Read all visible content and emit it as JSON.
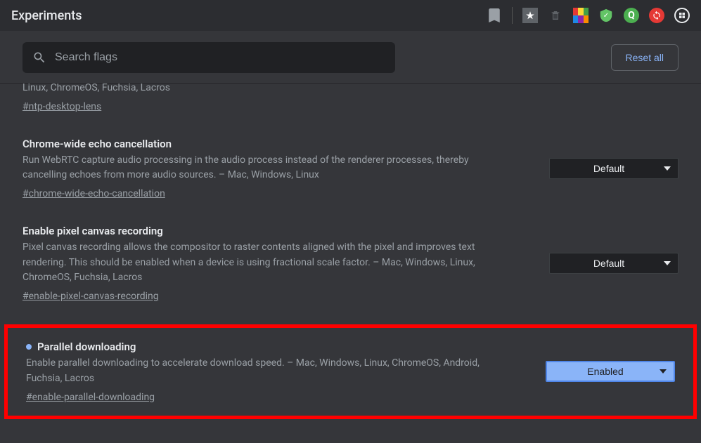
{
  "titlebar": {
    "title": "Experiments"
  },
  "toolbar": {
    "search_placeholder": "Search flags",
    "reset_label": "Reset all"
  },
  "flags": [
    {
      "title": "",
      "desc_partial": "Linux, ChromeOS, Fuchsia, Lacros",
      "anchor": "#ntp-desktop-lens",
      "select": ""
    },
    {
      "title": "Chrome-wide echo cancellation",
      "desc": "Run WebRTC capture audio processing in the audio process instead of the renderer processes, thereby cancelling echoes from more audio sources. – Mac, Windows, Linux",
      "anchor": "#chrome-wide-echo-cancellation",
      "select": "Default"
    },
    {
      "title": "Enable pixel canvas recording",
      "desc": "Pixel canvas recording allows the compositor to raster contents aligned with the pixel and improves text rendering. This should be enabled when a device is using fractional scale factor. – Mac, Windows, Linux, ChromeOS, Fuchsia, Lacros",
      "anchor": "#enable-pixel-canvas-recording",
      "select": "Default"
    },
    {
      "title": "Parallel downloading",
      "desc": "Enable parallel downloading to accelerate download speed. – Mac, Windows, Linux, ChromeOS, Android, Fuchsia, Lacros",
      "anchor": "#enable-parallel-downloading",
      "select": "Enabled"
    }
  ]
}
